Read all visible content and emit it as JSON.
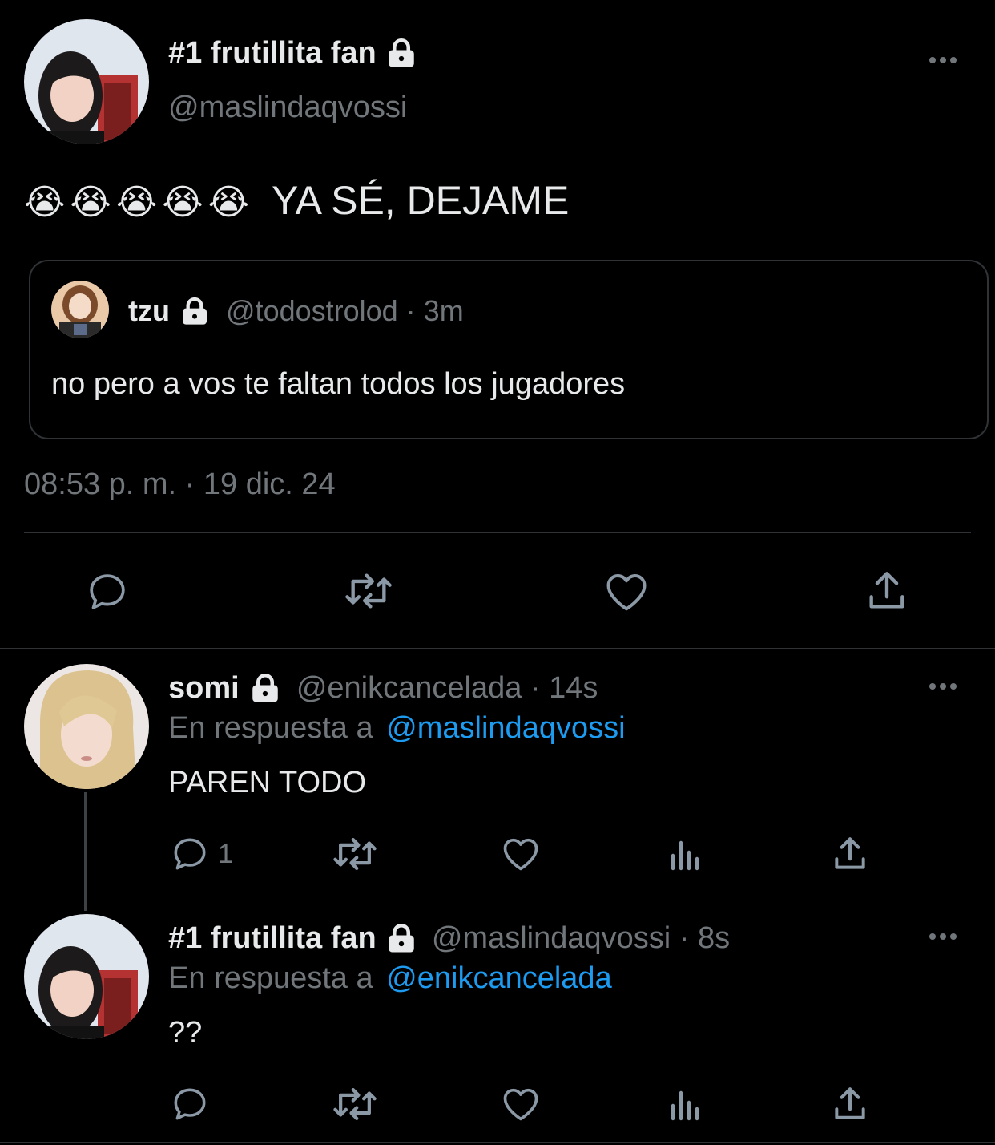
{
  "main_tweet": {
    "display_name": "#1 frutillita fan",
    "handle": "@maslindaqvossi",
    "emoji_text": "😭😭😭😭😭",
    "text": "YA SÉ, DEJAME",
    "timestamp": "08:53 p. m. · 19 dic. 24",
    "quoted": {
      "display_name": "tzu",
      "handle_time": "@todostrolod · 3m",
      "text": "no pero a vos te faltan todos los jugadores"
    }
  },
  "reply1": {
    "display_name": "somi",
    "handle_time": "@enikcancelada · 14s",
    "reply_prefix": "En respuesta a",
    "reply_to": "@maslindaqvossi",
    "text": "PAREN TODO",
    "reply_count": "1"
  },
  "reply2": {
    "display_name": "#1 frutillita fan",
    "handle_time": "@maslindaqvossi · 8s",
    "reply_prefix": "En respuesta a",
    "reply_to": "@enikcancelada",
    "text": "??",
    "reply_count": ""
  },
  "icons": {
    "reply": "reply-icon",
    "retweet": "retweet-icon",
    "like": "heart-icon",
    "share": "share-icon",
    "views": "analytics-icon",
    "lock": "lock-icon",
    "more": "more-icon"
  },
  "colors": {
    "background": "#000000",
    "text": "#e7e9ea",
    "secondary": "#71767b",
    "link": "#1d9bf0",
    "border": "#2f3336"
  }
}
